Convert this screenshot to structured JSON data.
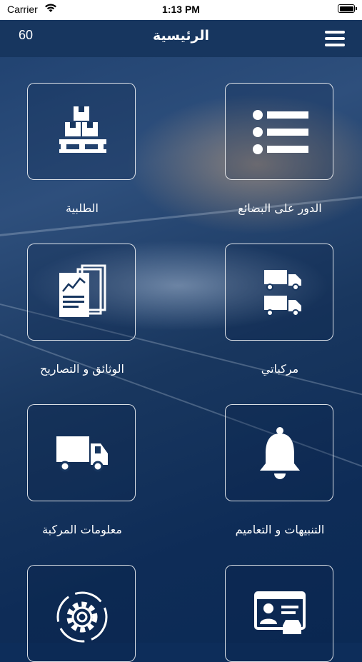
{
  "status_bar": {
    "carrier": "Carrier",
    "time": "1:13 PM"
  },
  "header": {
    "count": "60",
    "title": "الرئيسية"
  },
  "menu_items": [
    {
      "label": "الدور على البضائع",
      "icon": "list-icon"
    },
    {
      "label": "الطلبية",
      "icon": "boxes-icon"
    },
    {
      "label": "مركباتي",
      "icon": "trucks-icon"
    },
    {
      "label": "الوثائق و التصاريح",
      "icon": "documents-icon"
    },
    {
      "label": "التنبيهات و التعاميم",
      "icon": "bell-icon"
    },
    {
      "label": "معلومات المركبة",
      "icon": "truck-icon"
    },
    {
      "label": "",
      "icon": "driver-card-icon"
    },
    {
      "label": "",
      "icon": "settings-gear-icon"
    }
  ],
  "colors": {
    "navbar": "#17365f",
    "background": "#0d2d5a",
    "tile_border": "#ffffff"
  }
}
